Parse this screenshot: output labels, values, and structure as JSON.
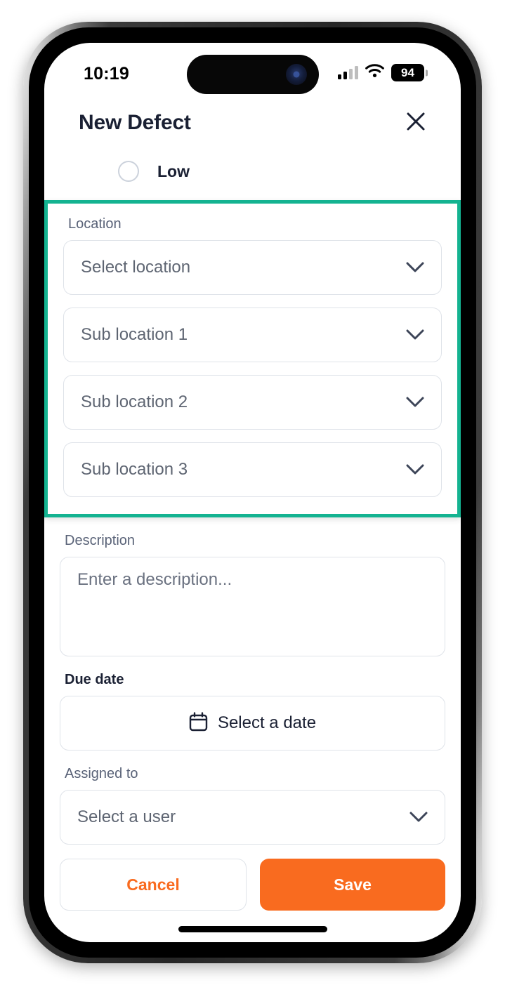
{
  "status_bar": {
    "time": "10:19",
    "battery_level": "94",
    "signal_icon": "signal-bars-icon",
    "wifi_icon": "wifi-icon",
    "battery_icon": "battery-icon"
  },
  "header": {
    "title": "New Defect",
    "close_icon": "close-icon"
  },
  "priority": {
    "selected": false,
    "label": "Low"
  },
  "location_group": {
    "highlighted": true,
    "highlight_color": "#14b391",
    "label": "Location",
    "fields": [
      {
        "name": "location",
        "placeholder": "Select location",
        "value": "",
        "icon": "chevron-down-icon"
      },
      {
        "name": "sub-location-1",
        "placeholder": "Sub location 1",
        "value": "",
        "icon": "chevron-down-icon"
      },
      {
        "name": "sub-location-2",
        "placeholder": "Sub location 2",
        "value": "",
        "icon": "chevron-down-icon"
      },
      {
        "name": "sub-location-3",
        "placeholder": "Sub location 3",
        "value": "",
        "icon": "chevron-down-icon"
      }
    ]
  },
  "description": {
    "label": "Description",
    "placeholder": "Enter a description...",
    "value": ""
  },
  "due_date": {
    "label": "Due date",
    "button_text": "Select a date",
    "icon": "calendar-icon"
  },
  "assigned_to": {
    "label": "Assigned to",
    "placeholder": "Select a user",
    "value": "",
    "icon": "chevron-down-icon"
  },
  "footer": {
    "cancel_label": "Cancel",
    "save_label": "Save",
    "accent_color": "#f96b1f"
  }
}
